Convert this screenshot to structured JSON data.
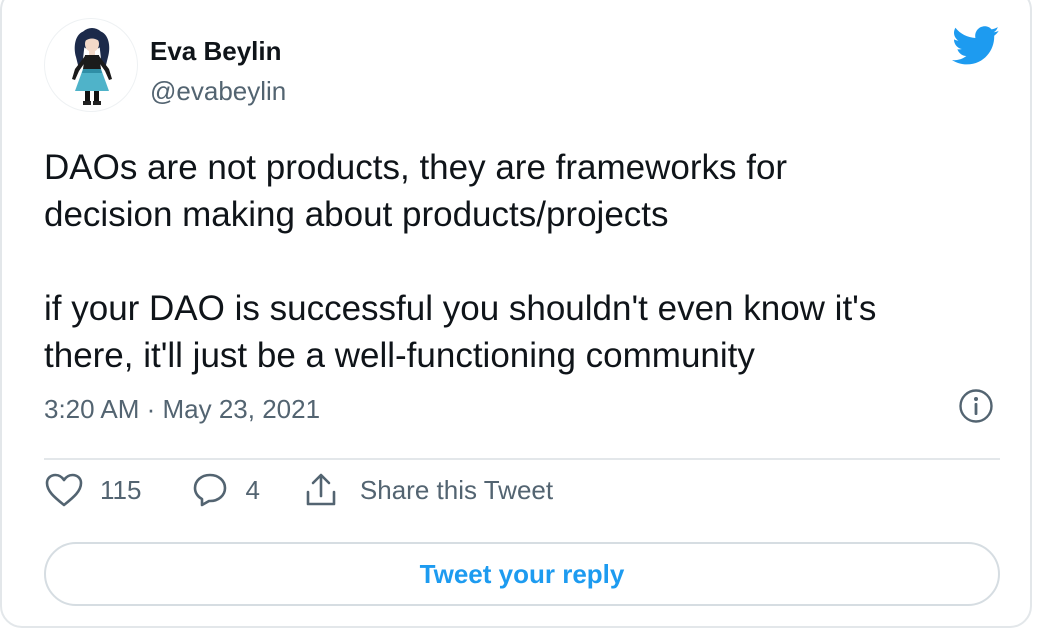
{
  "author": {
    "name": "Eva Beylin",
    "handle": "@evabeylin",
    "avatar_icon": "anime-character-avatar"
  },
  "brand": {
    "icon": "twitter-bird-icon",
    "color": "#1d9bf0"
  },
  "tweet": {
    "lines": [
      "DAOs are not products, they are frameworks for",
      "decision making about products/projects",
      "if your DAO is successful you shouldn't even know it's",
      "there, it'll just be a well-functioning community"
    ],
    "timestamp": "3:20 AM · May 23, 2021"
  },
  "actions": {
    "likes": "115",
    "replies": "4",
    "share_label": "Share this Tweet"
  },
  "reply_button": {
    "label": "Tweet your reply"
  },
  "colors": {
    "text": "#0f1419",
    "secondary": "#536471",
    "border": "#e3e7ea",
    "accent": "#1d9bf0"
  }
}
